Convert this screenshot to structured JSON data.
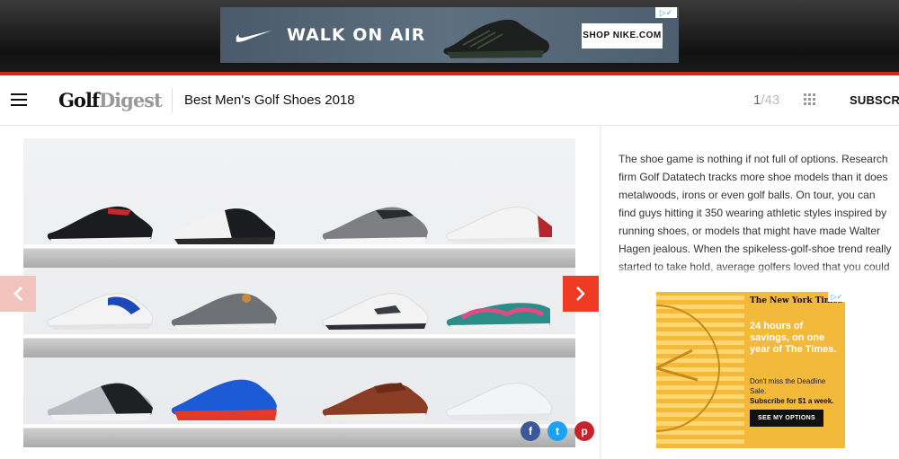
{
  "top_ad": {
    "headline": "WALK ON AIR",
    "cta_label": "SHOP NIKE.COM",
    "ad_choices": "▷✓",
    "brand_color": "#d42a12"
  },
  "header": {
    "logo_golf": "Golf",
    "logo_digest": "Digest",
    "gallery_title": "Best Men's Golf Shoes 2018",
    "counter_current": "1",
    "counter_total": "/43",
    "subscribe_label": "SUBSCRIBE",
    "menu_icon": "hamburger-icon",
    "grid_icon": "grid-icon"
  },
  "gallery": {
    "prev_icon": "chevron-left-icon",
    "next_icon": "chevron-right-icon",
    "accent_color": "#ef3b24",
    "share": {
      "facebook": "f",
      "twitter": "t",
      "pinterest": "p"
    }
  },
  "article": {
    "text": "The shoe game is nothing if not full of options. Research firm Golf Datatech tracks more shoe models than it does metalwoods, irons or even golf balls. On tour, you can find guys hitting it 350 wearing athletic styles inspired by running shoes, or models that might have made Walter Hagen jealous. When the spikeless-golf-shoe trend really started to take hold, average golfers loved that you could wear your golf shoes all over, rather than merely on golf course. But now, trends..."
  },
  "side_ad": {
    "masthead": "The New York Times",
    "offer": "24 hours of savings, on one year of The Times.",
    "deadline": "Don't miss the Deadline Sale.",
    "price": "Subscribe for $1 a week.",
    "cta_label": "SEE MY OPTIONS",
    "ad_choices": "▷✓",
    "ad_color": "#f3b93a"
  }
}
